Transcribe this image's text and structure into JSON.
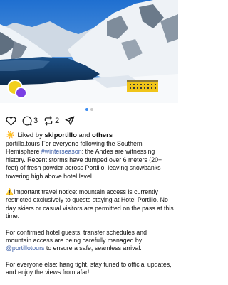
{
  "post": {
    "media_count": 2,
    "active_index": 0,
    "image_alt": "Snowy Andes mountains above a frozen lake with a yellow hotel building",
    "collaborators": [
      "portillo-avatar",
      "collab-avatar"
    ],
    "counts": {
      "comments": "3",
      "reposts": "2"
    },
    "liked_by": {
      "prefix": "Liked by ",
      "user": "skiportillo",
      "conj": " and ",
      "others": "others"
    },
    "caption": {
      "username": "portillo.tours",
      "p1_before": " For everyone following the Southern Hemisphere ",
      "hashtag": "#winterseason",
      "p1_after": ": the Andes are witnessing history. Recent storms have dumped over 6 meters (20+ feet) of fresh powder across Portillo, leaving snowbanks towering high above hotel level.",
      "p2": "⚠️Important travel notice: mountain access is currently restricted exclusively to guests staying at Hotel Portillo. No day skiers or casual visitors are permitted on the pass at this time.",
      "p3_before": "For confirmed hotel guests, transfer schedules and mountain access are being carefully managed by ",
      "mention": "@portillotours",
      "p3_after": " to ensure a safe, seamless arrival.",
      "p4": "For everyone else: hang tight, stay tuned to official updates, and enjoy the views from afar!"
    },
    "colors": {
      "link": "#3b5ea8",
      "active_dot": "#3c8cf0",
      "hotel": "#f0c419"
    }
  }
}
